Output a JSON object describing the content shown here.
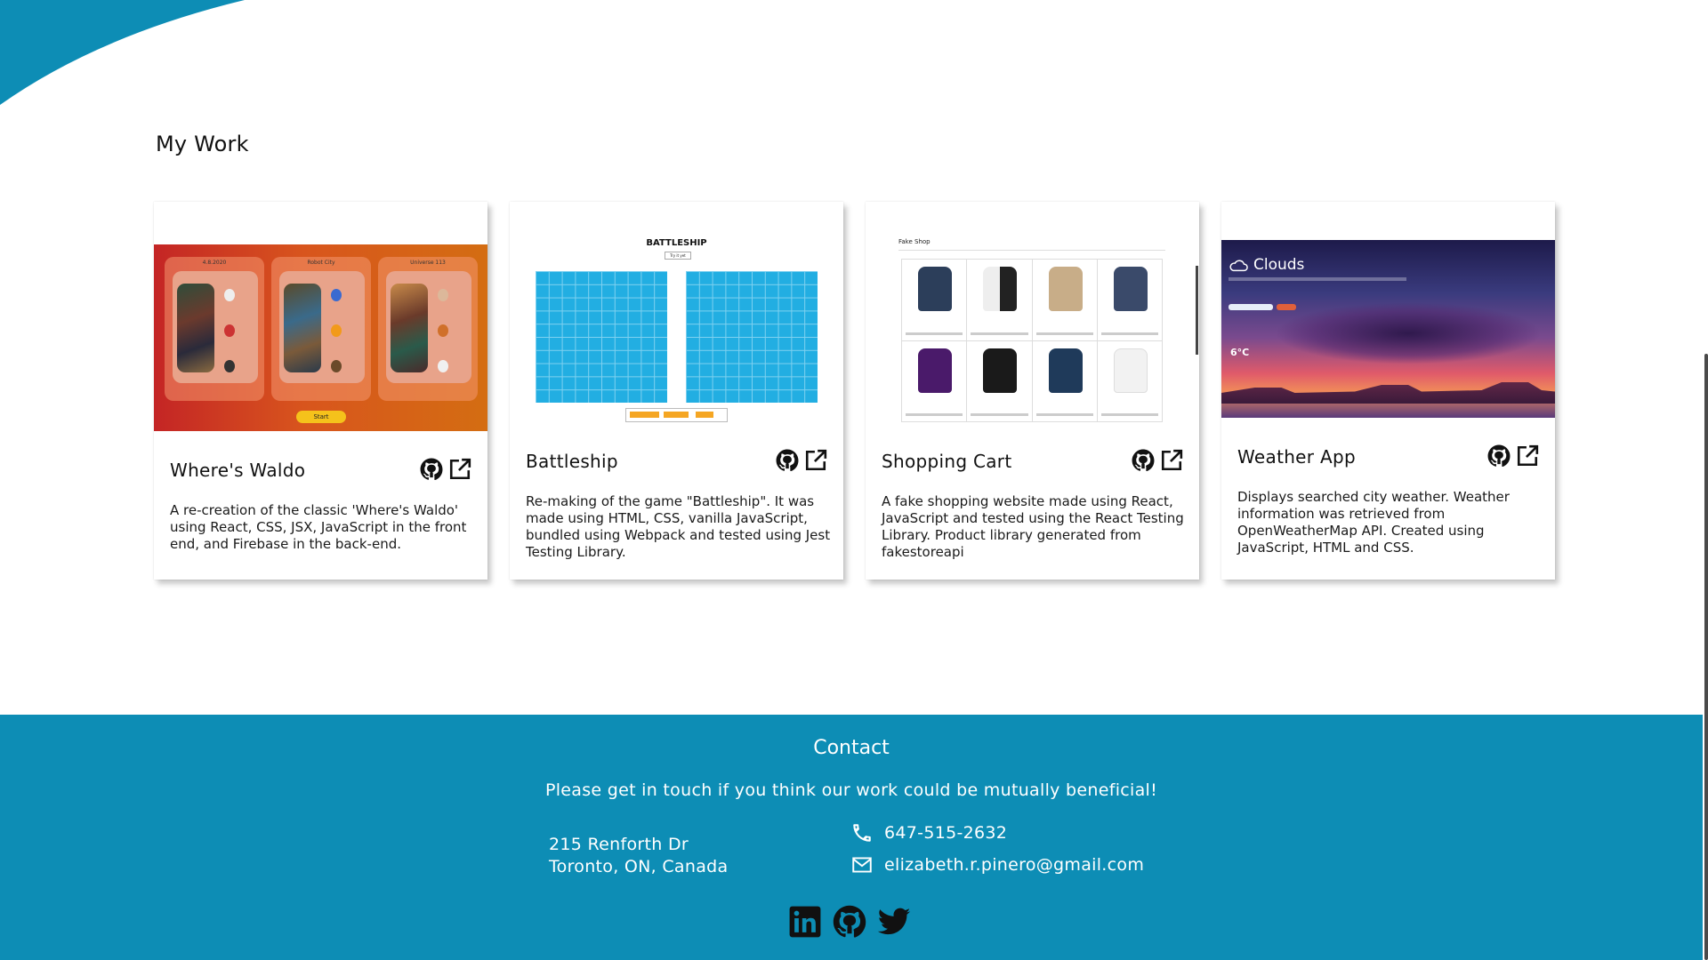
{
  "colors": {
    "accent": "#0d8db5",
    "footer_text": "#ffffff"
  },
  "section": {
    "title": "My Work"
  },
  "projects": [
    {
      "title": "Where's Waldo",
      "description": "A re-creation of the classic 'Where's Waldo' using React, CSS, JSX, JavaScript in the front end, and Firebase in the back-end.",
      "thumbnail": {
        "panels": [
          "4.8.2020",
          "Robot City",
          "Universe 113"
        ],
        "start_label": "Start"
      }
    },
    {
      "title": "Battleship",
      "description": "Re-making of the game \"Battleship\". It was made using HTML, CSS, vanilla JavaScript, bundled using Webpack and tested using Jest Testing Library.",
      "thumbnail": {
        "heading": "BATTLESHIP",
        "button_label": "Try it yet"
      }
    },
    {
      "title": "Shopping Cart",
      "description": "A fake shopping website made using React, JavaScript and tested using the React Testing Library. Product library generated from fakestoreapi",
      "thumbnail": {
        "store_name": "Fake Shop"
      }
    },
    {
      "title": "Weather App",
      "description": "Displays searched city weather. Weather information was retrieved from OpenWeatherMap API. Created using JavaScript, HTML and CSS.",
      "thumbnail": {
        "condition": "Clouds",
        "temperature": "6°C"
      }
    }
  ],
  "icons": {
    "repo": "github-icon",
    "live": "external-link-icon"
  },
  "contact": {
    "title": "Contact",
    "subtitle": "Please get in touch if you think our work could be mutually beneficial!",
    "address_line1": "215 Renforth Dr",
    "address_line2": "Toronto, ON, Canada",
    "phone": "647-515-2632",
    "email": "elizabeth.r.pinero@gmail.com"
  },
  "socials": [
    "linkedin-icon",
    "github-icon",
    "twitter-icon"
  ]
}
